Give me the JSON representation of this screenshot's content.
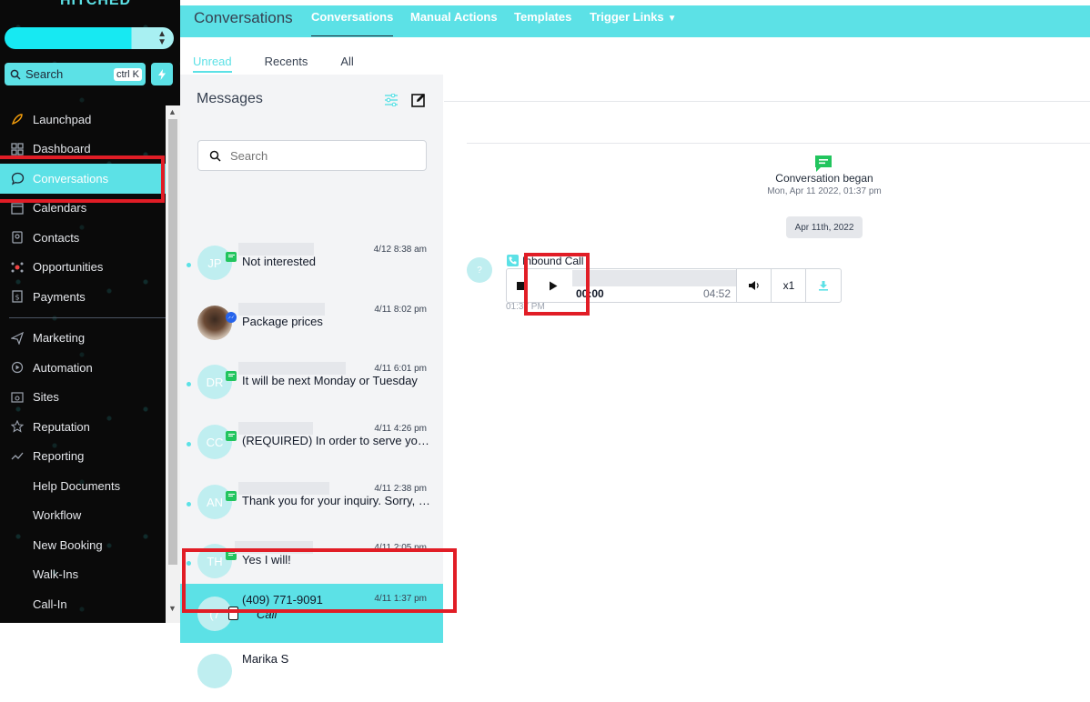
{
  "sidebar": {
    "brand": "HITCHED",
    "search_label": "Search",
    "search_shortcut": "ctrl K",
    "items": [
      {
        "label": "Launchpad",
        "icon": "rocket-icon"
      },
      {
        "label": "Dashboard",
        "icon": "dashboard-icon"
      },
      {
        "label": "Conversations",
        "icon": "chat-bubble-icon",
        "active": true
      },
      {
        "label": "Calendars",
        "icon": "calendar-icon"
      },
      {
        "label": "Contacts",
        "icon": "contacts-icon"
      },
      {
        "label": "Opportunities",
        "icon": "opportunities-icon"
      },
      {
        "label": "Payments",
        "icon": "payments-icon"
      }
    ],
    "items2": [
      {
        "label": "Marketing",
        "icon": "send-icon"
      },
      {
        "label": "Automation",
        "icon": "automation-icon"
      },
      {
        "label": "Sites",
        "icon": "sites-icon"
      },
      {
        "label": "Reputation",
        "icon": "star-icon"
      },
      {
        "label": "Reporting",
        "icon": "reporting-icon"
      },
      {
        "label": "Help Documents"
      },
      {
        "label": "Workflow"
      },
      {
        "label": "New Booking"
      },
      {
        "label": "Walk-Ins"
      },
      {
        "label": "Call-In"
      }
    ]
  },
  "topbar": {
    "title": "Conversations",
    "tabs": [
      "Conversations",
      "Manual Actions",
      "Templates",
      "Trigger Links"
    ]
  },
  "list": {
    "subtabs": [
      "Unread",
      "Recents",
      "All"
    ],
    "heading": "Messages",
    "search_placeholder": "Search",
    "rows": [
      {
        "initials": "JP",
        "time": "4/12 8:38 am",
        "snippet": "Not interested",
        "channel": "sms"
      },
      {
        "initials": "",
        "time": "4/11 8:02 pm",
        "snippet": "Package prices",
        "channel": "messenger"
      },
      {
        "initials": "DR",
        "time": "4/11 6:01 pm",
        "snippet": "It will be next Monday or Tuesday",
        "channel": "sms"
      },
      {
        "initials": "CC",
        "time": "4/11 4:26 pm",
        "snippet": "(REQUIRED) In order to serve you best, please enter the total",
        "channel": "sms"
      },
      {
        "initials": "AN",
        "time": "4/11 2:38 pm",
        "snippet": "Thank you for your inquiry. Sorry, it is booked for that date",
        "channel": "sms"
      },
      {
        "initials": "TH",
        "time": "4/11 2:05 pm",
        "snippet": "Yes I will!",
        "channel": "sms"
      },
      {
        "initials": "(7",
        "time": "4/11 1:37 pm",
        "name": "(409) 771-9091",
        "subtitle": "Call",
        "channel": "phone",
        "selected": true
      }
    ],
    "last_row_partial": "Marika S"
  },
  "thread": {
    "began_label": "Conversation began",
    "began_time": "Mon, Apr 11 2022, 01:37 pm",
    "date_chip": "Apr 11th, 2022",
    "caller_avatar": "?",
    "call_label": "Inbound Call",
    "player": {
      "current": "00:00",
      "duration": "04:52",
      "speed": "x1"
    },
    "message_time": "01:37 PM"
  }
}
